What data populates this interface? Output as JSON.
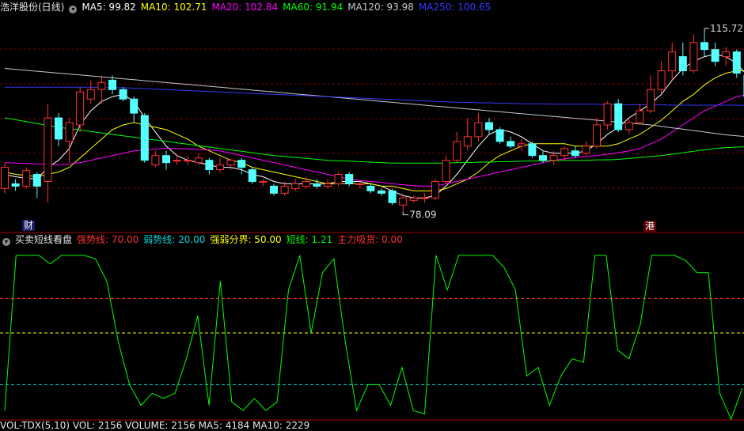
{
  "main_header": {
    "title": "浩洋股份(日线)",
    "items": [
      {
        "label": "MA5: 99.82",
        "color": "#ffffff"
      },
      {
        "label": "MA10: 102.71",
        "color": "#ffff00"
      },
      {
        "label": "MA20: 102.84",
        "color": "#ff00ff"
      },
      {
        "label": "MA60: 91.94",
        "color": "#00ff00"
      },
      {
        "label": "MA120: 93.98",
        "color": "#c8c8c8"
      },
      {
        "label": "MA250: 100.65",
        "color": "#3838ff"
      }
    ]
  },
  "indicator_header": {
    "title": "买卖短线看盘",
    "items": [
      {
        "label": "强势线: 70.00",
        "color": "#ff3030"
      },
      {
        "label": "弱势线: 20.00",
        "color": "#00d8d8"
      },
      {
        "label": "强弱分界: 50.00",
        "color": "#ffff00"
      },
      {
        "label": "短线: 1.21",
        "color": "#00ff00"
      },
      {
        "label": "主力吸货: 0.00",
        "color": "#ff3030"
      }
    ]
  },
  "bottom_header": {
    "text": "VOL-TDX(5,10) VOL: 2156 VOLUME: 2156 MA5: 4184 MA10: 2229"
  },
  "markers": {
    "high_label": "115.72",
    "low_label": "78.09",
    "tag_left": "财",
    "tag_right": "港"
  },
  "colors": {
    "up": "#ff3232",
    "down": "#54ffff",
    "grid": "#7a0000",
    "axis": "#a00000"
  },
  "chart_data": [
    {
      "type": "candlestick",
      "title": "浩洋股份(日线)",
      "ylim": [
        74,
        120
      ],
      "candles": [
        [
          83.0,
          87.5,
          88.5,
          82.0
        ],
        [
          84.0,
          83.5,
          85.0,
          82.5
        ],
        [
          83.5,
          86.8,
          87.5,
          83.0
        ],
        [
          86.0,
          83.5,
          86.5,
          81.0
        ],
        [
          84.5,
          98.0,
          101.0,
          80.0
        ],
        [
          98.0,
          93.5,
          99.0,
          92.0
        ],
        [
          93.0,
          97.0,
          98.0,
          88.5
        ],
        [
          96.5,
          103.5,
          104.5,
          95.0
        ],
        [
          102.0,
          104.0,
          106.0,
          101.0
        ],
        [
          104.0,
          105.5,
          107.0,
          101.0
        ],
        [
          106.0,
          104.0,
          107.0,
          103.0
        ],
        [
          104.0,
          102.0,
          104.5,
          101.5
        ],
        [
          102.0,
          99.0,
          102.5,
          97.0
        ],
        [
          98.5,
          89.0,
          99.0,
          88.5
        ],
        [
          88.0,
          90.0,
          91.0,
          87.5
        ],
        [
          90.0,
          88.5,
          91.0,
          87.0
        ],
        [
          89.0,
          89.0,
          90.0,
          88.0
        ],
        [
          89.0,
          89.0,
          90.0,
          88.0
        ],
        [
          88.5,
          89.5,
          90.5,
          88.0
        ],
        [
          89.0,
          87.0,
          89.5,
          86.0
        ],
        [
          87.0,
          88.0,
          89.5,
          86.5
        ],
        [
          88.0,
          89.0,
          89.5,
          87.0
        ],
        [
          89.0,
          87.5,
          89.5,
          86.0
        ],
        [
          87.0,
          84.5,
          87.5,
          84.0
        ],
        [
          84.5,
          84.5,
          85.0,
          83.5
        ],
        [
          83.5,
          82.0,
          84.0,
          81.5
        ],
        [
          82.0,
          83.5,
          84.5,
          81.5
        ],
        [
          83.0,
          84.0,
          85.0,
          82.5
        ],
        [
          83.5,
          84.5,
          85.5,
          83.0
        ],
        [
          84.0,
          83.5,
          85.0,
          83.0
        ],
        [
          83.5,
          84.0,
          85.0,
          83.0
        ],
        [
          84.0,
          86.0,
          86.5,
          83.5
        ],
        [
          86.0,
          84.0,
          86.5,
          83.5
        ],
        [
          84.0,
          84.0,
          84.5,
          83.0
        ],
        [
          83.5,
          82.5,
          84.0,
          82.0
        ],
        [
          82.5,
          82.0,
          83.0,
          81.5
        ],
        [
          82.5,
          80.0,
          83.0,
          79.5
        ],
        [
          79.5,
          81.0,
          82.0,
          78.09
        ],
        [
          80.5,
          81.0,
          81.5,
          80.0
        ],
        [
          81.0,
          81.0,
          82.0,
          80.0
        ],
        [
          81.0,
          84.5,
          85.0,
          80.5
        ],
        [
          84.5,
          89.0,
          90.0,
          84.0
        ],
        [
          89.0,
          93.0,
          95.0,
          88.5
        ],
        [
          92.0,
          94.0,
          98.0,
          91.0
        ],
        [
          94.0,
          97.0,
          99.0,
          93.0
        ],
        [
          97.0,
          95.5,
          98.0,
          94.5
        ],
        [
          95.5,
          93.0,
          96.0,
          92.5
        ],
        [
          93.0,
          92.0,
          94.0,
          91.5
        ],
        [
          92.0,
          92.5,
          93.5,
          91.0
        ],
        [
          92.5,
          90.0,
          93.0,
          89.5
        ],
        [
          90.0,
          89.0,
          91.0,
          88.5
        ],
        [
          89.0,
          90.0,
          91.0,
          88.0
        ],
        [
          90.0,
          91.5,
          92.0,
          89.0
        ],
        [
          91.0,
          90.0,
          92.0,
          89.5
        ],
        [
          90.5,
          92.0,
          93.0,
          90.0
        ],
        [
          92.0,
          96.5,
          98.0,
          91.5
        ],
        [
          96.5,
          101.0,
          101.5,
          95.5
        ],
        [
          101.0,
          95.5,
          102.0,
          95.0
        ],
        [
          95.5,
          97.0,
          98.0,
          94.5
        ],
        [
          97.0,
          99.5,
          101.0,
          96.5
        ],
        [
          99.5,
          104.0,
          107.0,
          99.0
        ],
        [
          104.0,
          108.0,
          110.0,
          103.0
        ],
        [
          108.0,
          112.0,
          114.0,
          106.0
        ],
        [
          111.0,
          108.0,
          114.0,
          107.0
        ],
        [
          108.0,
          114.0,
          115.72,
          107.5
        ],
        [
          114.0,
          112.5,
          116.0,
          111.0
        ],
        [
          112.5,
          110.0,
          114.0,
          109.0
        ],
        [
          111.0,
          112.0,
          113.0,
          109.0
        ],
        [
          112.0,
          107.5,
          112.5,
          106.5
        ],
        [
          107.0,
          102.5,
          108.0,
          101.0
        ]
      ],
      "moving_averages": [
        {
          "name": "MA5",
          "color": "#ffffff",
          "values": [
            86.0,
            85.5,
            85.2,
            85.0,
            87.5,
            89.0,
            91.5,
            96.5,
            99.5,
            101.5,
            102.5,
            103.0,
            101.5,
            98.0,
            95.0,
            92.0,
            90.0,
            89.0,
            88.5,
            88.0,
            87.5,
            87.5,
            87.0,
            86.0,
            85.5,
            84.5,
            84.0,
            84.0,
            84.0,
            84.0,
            84.0,
            84.5,
            84.5,
            84.5,
            84.0,
            83.5,
            82.5,
            81.5,
            81.0,
            81.0,
            81.5,
            83.5,
            86.0,
            89.0,
            92.0,
            94.5,
            95.5,
            95.0,
            94.0,
            92.5,
            91.0,
            90.5,
            90.5,
            90.5,
            91.0,
            92.5,
            94.5,
            96.0,
            98.0,
            99.5,
            101.0,
            103.0,
            106.0,
            108.5,
            110.0,
            111.0,
            111.5,
            111.0,
            109.5,
            107.0
          ]
        },
        {
          "name": "MA10",
          "color": "#ffff00",
          "values": [
            86.5,
            86.0,
            85.8,
            85.5,
            86.0,
            86.5,
            87.5,
            89.5,
            91.5,
            93.5,
            95.5,
            96.5,
            97.0,
            96.5,
            96.0,
            95.5,
            94.5,
            93.5,
            92.0,
            91.0,
            90.0,
            89.0,
            88.5,
            87.5,
            87.0,
            86.5,
            86.0,
            85.5,
            85.0,
            84.5,
            84.0,
            84.0,
            84.0,
            84.0,
            84.0,
            83.5,
            83.5,
            83.0,
            82.5,
            82.5,
            82.5,
            83.0,
            84.0,
            85.0,
            86.5,
            88.5,
            90.0,
            91.0,
            92.0,
            92.5,
            92.5,
            92.5,
            92.5,
            92.0,
            92.0,
            92.0,
            92.0,
            92.5,
            93.5,
            94.5,
            96.0,
            97.5,
            99.5,
            101.5,
            103.0,
            105.0,
            106.5,
            107.5,
            108.0,
            108.0
          ]
        },
        {
          "name": "MA20",
          "color": "#ff00ff",
          "values": [
            88.5,
            88.4,
            88.3,
            88.2,
            88.1,
            88.0,
            88.2,
            88.5,
            89.0,
            89.5,
            90.0,
            90.5,
            91.0,
            91.2,
            91.4,
            91.5,
            91.5,
            91.4,
            91.3,
            91.2,
            91.0,
            90.5,
            90.0,
            89.5,
            89.0,
            88.5,
            88.0,
            87.5,
            87.0,
            86.5,
            86.0,
            85.5,
            85.0,
            84.7,
            84.5,
            84.3,
            84.0,
            83.8,
            83.6,
            83.5,
            83.5,
            84.0,
            84.5,
            85.0,
            85.5,
            86.0,
            86.5,
            87.0,
            87.5,
            88.0,
            88.5,
            89.0,
            89.3,
            89.6,
            89.8,
            90.0,
            90.3,
            90.6,
            91.0,
            91.5,
            92.5,
            93.5,
            95.0,
            96.5,
            98.0,
            99.5,
            100.5,
            101.5,
            102.5,
            103.0
          ]
        },
        {
          "name": "MA60",
          "color": "#00ff00",
          "values": [
            98.0,
            97.6,
            97.2,
            96.8,
            96.4,
            96.0,
            95.7,
            95.4,
            95.1,
            94.8,
            94.5,
            94.2,
            93.9,
            93.6,
            93.3,
            93.0,
            92.7,
            92.4,
            92.1,
            91.8,
            91.5,
            91.2,
            90.9,
            90.6,
            90.3,
            90.0,
            89.8,
            89.6,
            89.4,
            89.2,
            89.0,
            88.9,
            88.8,
            88.7,
            88.6,
            88.5,
            88.4,
            88.4,
            88.4,
            88.4,
            88.4,
            88.4,
            88.5,
            88.5,
            88.6,
            88.6,
            88.7,
            88.7,
            88.8,
            88.8,
            88.9,
            88.9,
            89.0,
            89.0,
            89.0,
            89.1,
            89.1,
            89.2,
            89.4,
            89.6,
            89.8,
            90.0,
            90.3,
            90.6,
            90.9,
            91.2,
            91.5,
            91.7,
            91.8,
            91.9
          ]
        },
        {
          "name": "MA120",
          "color": "#c8c8c8",
          "values": [
            108.5,
            108.3,
            108.1,
            107.9,
            107.7,
            107.5,
            107.3,
            107.1,
            106.9,
            106.7,
            106.5,
            106.3,
            106.1,
            105.9,
            105.7,
            105.5,
            105.3,
            105.1,
            104.9,
            104.7,
            104.5,
            104.3,
            104.1,
            103.9,
            103.7,
            103.5,
            103.3,
            103.1,
            102.9,
            102.7,
            102.5,
            102.3,
            102.1,
            101.9,
            101.7,
            101.5,
            101.3,
            101.1,
            100.9,
            100.7,
            100.5,
            100.3,
            100.1,
            99.9,
            99.7,
            99.5,
            99.3,
            99.1,
            98.9,
            98.7,
            98.5,
            98.3,
            98.1,
            97.9,
            97.7,
            97.5,
            97.3,
            97.1,
            96.9,
            96.7,
            96.5,
            96.2,
            95.9,
            95.6,
            95.3,
            95.0,
            94.7,
            94.4,
            94.2,
            94.0
          ]
        },
        {
          "name": "MA250",
          "color": "#3838ff",
          "values": [
            104.5,
            104.5,
            104.5,
            104.5,
            104.5,
            104.5,
            104.5,
            104.5,
            104.5,
            104.4,
            104.4,
            104.4,
            104.3,
            104.2,
            104.1,
            104.0,
            103.9,
            103.8,
            103.7,
            103.6,
            103.5,
            103.4,
            103.3,
            103.2,
            103.1,
            103.0,
            102.9,
            102.8,
            102.7,
            102.6,
            102.5,
            102.4,
            102.3,
            102.2,
            102.1,
            102.0,
            101.9,
            101.8,
            101.7,
            101.6,
            101.5,
            101.4,
            101.3,
            101.3,
            101.2,
            101.2,
            101.1,
            101.1,
            101.0,
            101.0,
            101.0,
            100.9,
            100.9,
            100.9,
            100.9,
            100.9,
            100.8,
            100.8,
            100.8,
            100.8,
            100.8,
            100.8,
            100.7,
            100.7,
            100.7,
            100.7,
            100.7,
            100.7,
            100.7,
            100.65
          ]
        }
      ]
    },
    {
      "type": "line",
      "title": "买卖短线看盘",
      "ylim": [
        0,
        100
      ],
      "levels": [
        {
          "name": "强势线",
          "value": 70,
          "color": "#ff3030"
        },
        {
          "name": "弱势线",
          "value": 20,
          "color": "#00d8d8"
        },
        {
          "name": "强弱分界",
          "value": 50,
          "color": "#ffff00"
        }
      ],
      "series": [
        {
          "name": "短线",
          "color": "#00ff00",
          "values": [
            5,
            95,
            95,
            95,
            90,
            95,
            95,
            95,
            93,
            80,
            45,
            20,
            8,
            15,
            12,
            15,
            35,
            60,
            8,
            80,
            10,
            5,
            12,
            5,
            10,
            75,
            95,
            50,
            85,
            93,
            45,
            5,
            20,
            20,
            8,
            30,
            5,
            3,
            95,
            75,
            95,
            95,
            95,
            95,
            88,
            75,
            25,
            30,
            8,
            25,
            35,
            33,
            95,
            95,
            40,
            35,
            55,
            95,
            95,
            95,
            92,
            85,
            85,
            15,
            0,
            18
          ]
        }
      ]
    }
  ]
}
